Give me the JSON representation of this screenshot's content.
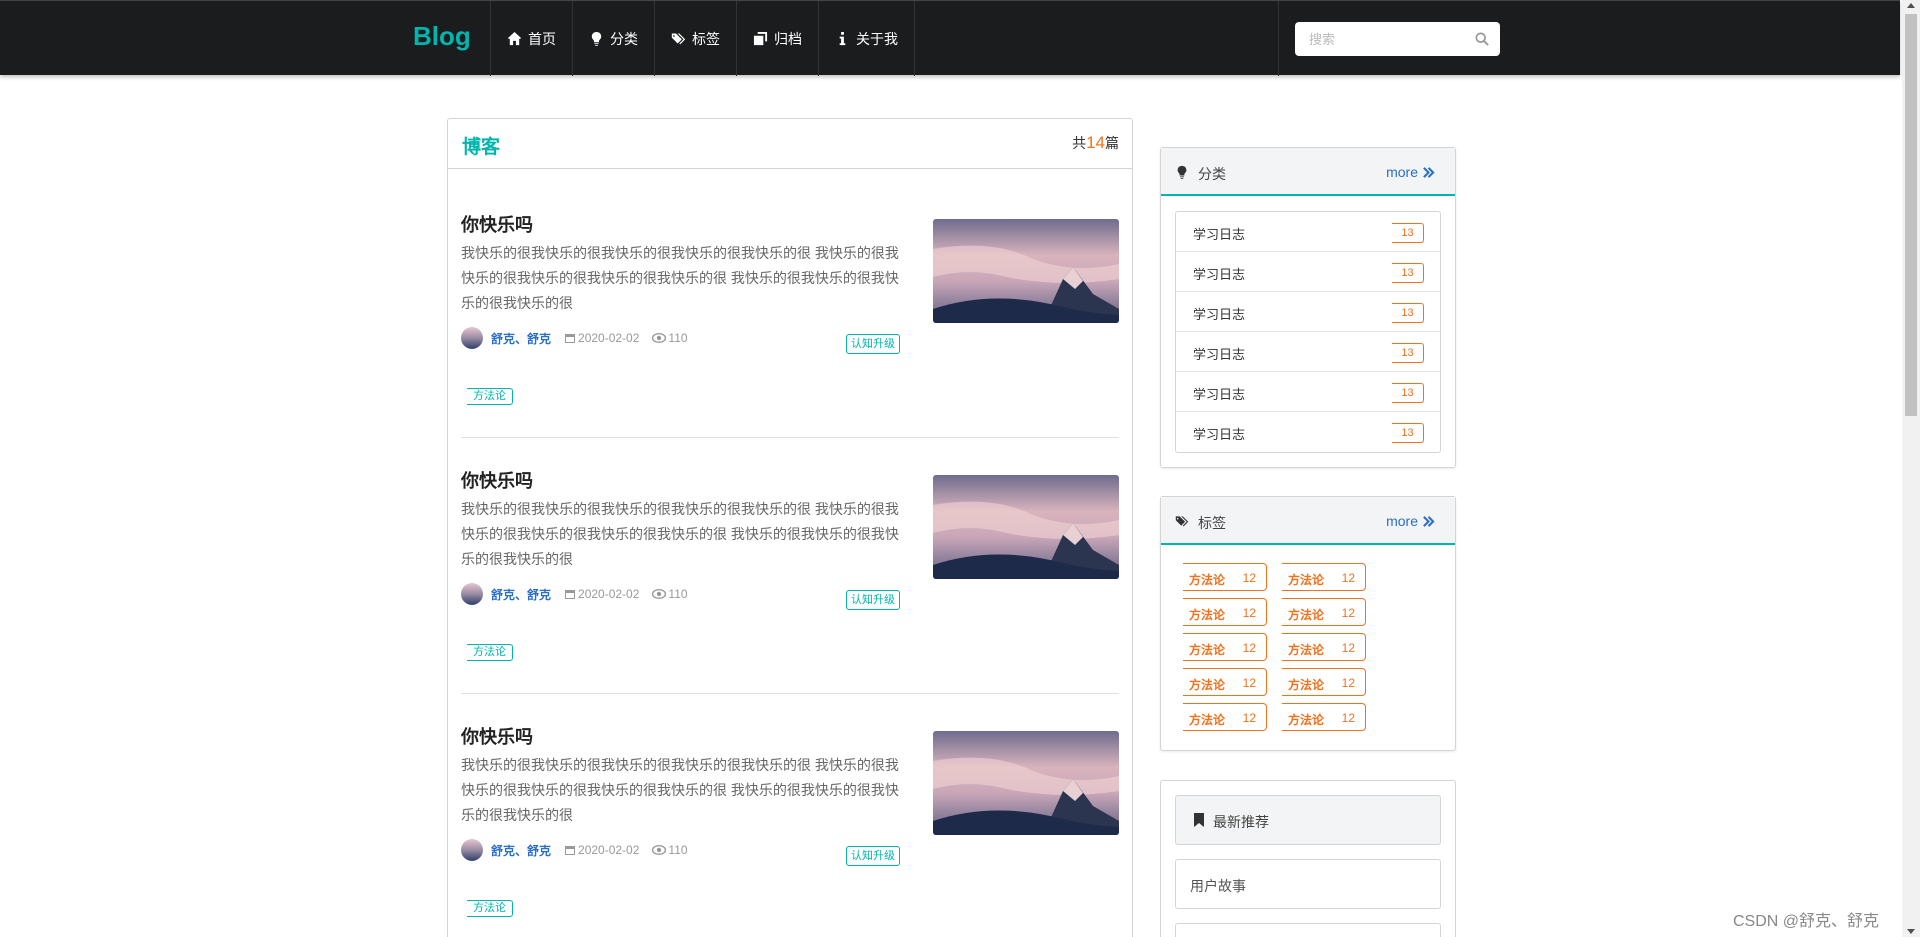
{
  "nav": {
    "brand": "Blog",
    "items": [
      {
        "label": "首页",
        "icon": "home-icon"
      },
      {
        "label": "分类",
        "icon": "lightbulb-icon"
      },
      {
        "label": "标签",
        "icon": "tags-icon"
      },
      {
        "label": "归档",
        "icon": "clone-icon"
      },
      {
        "label": "关于我",
        "icon": "info-icon"
      }
    ],
    "search_placeholder": "搜索"
  },
  "blog": {
    "title": "博客",
    "count_prefix": "共",
    "count": "14",
    "count_suffix": "篇",
    "posts": [
      {
        "title": "你快乐吗",
        "excerpt": "我快乐的很我快乐的很我快乐的很我快乐的很我快乐的很 我快乐的很我快乐的很我快乐的很我快乐的很我快乐的很 我快乐的很我快乐的很我快乐的很我快乐的很",
        "author": "舒克、舒克",
        "date": "2020-02-02",
        "views": "110",
        "category": "认知升级",
        "tag": "方法论"
      },
      {
        "title": "你快乐吗",
        "excerpt": "我快乐的很我快乐的很我快乐的很我快乐的很我快乐的很 我快乐的很我快乐的很我快乐的很我快乐的很我快乐的很 我快乐的很我快乐的很我快乐的很我快乐的很",
        "author": "舒克、舒克",
        "date": "2020-02-02",
        "views": "110",
        "category": "认知升级",
        "tag": "方法论"
      },
      {
        "title": "你快乐吗",
        "excerpt": "我快乐的很我快乐的很我快乐的很我快乐的很我快乐的很 我快乐的很我快乐的很我快乐的很我快乐的很我快乐的很 我快乐的很我快乐的很我快乐的很我快乐的很",
        "author": "舒克、舒克",
        "date": "2020-02-02",
        "views": "110",
        "category": "认知升级",
        "tag": "方法论"
      }
    ]
  },
  "sidebar": {
    "categories": {
      "title": "分类",
      "more": "more",
      "items": [
        {
          "label": "学习日志",
          "count": "13"
        },
        {
          "label": "学习日志",
          "count": "13"
        },
        {
          "label": "学习日志",
          "count": "13"
        },
        {
          "label": "学习日志",
          "count": "13"
        },
        {
          "label": "学习日志",
          "count": "13"
        },
        {
          "label": "学习日志",
          "count": "13"
        }
      ]
    },
    "tags": {
      "title": "标签",
      "more": "more",
      "items": [
        {
          "label": "方法论",
          "count": "12"
        },
        {
          "label": "方法论",
          "count": "12"
        },
        {
          "label": "方法论",
          "count": "12"
        },
        {
          "label": "方法论",
          "count": "12"
        },
        {
          "label": "方法论",
          "count": "12"
        },
        {
          "label": "方法论",
          "count": "12"
        },
        {
          "label": "方法论",
          "count": "12"
        },
        {
          "label": "方法论",
          "count": "12"
        },
        {
          "label": "方法论",
          "count": "12"
        },
        {
          "label": "方法论",
          "count": "12"
        }
      ]
    },
    "recommend": {
      "title": "最新推荐",
      "items": [
        "用户故事",
        ""
      ]
    }
  },
  "watermark": "CSDN @舒克、舒克",
  "colors": {
    "teal": "#00b5ad",
    "orange": "#f2711c",
    "blue": "#2a6fc6",
    "navbar": "#1b1c1d"
  }
}
